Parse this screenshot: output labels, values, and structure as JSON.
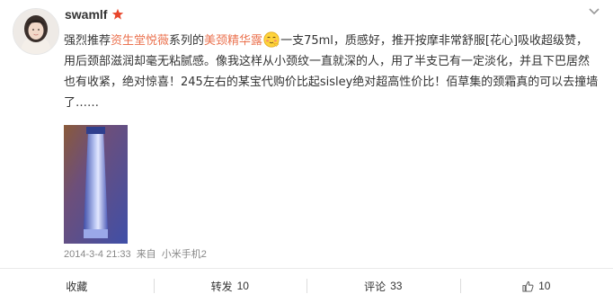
{
  "user": {
    "name": "swamlf",
    "vip_icon": "star-icon",
    "avatar_icon": "avatar-photo"
  },
  "post": {
    "text": [
      {
        "t": "强烈推荐",
        "hl": false
      },
      {
        "t": "资生堂悦薇",
        "hl": true
      },
      {
        "t": "系列的",
        "hl": false
      },
      {
        "t": "美颈精华露",
        "hl": true
      },
      {
        "emoji": "shy-smile-emoji"
      },
      {
        "t": "一支75ml，质感好，推开按摩非常舒服[花心]吸收超级赞，用后颈部滋润却毫无粘腻感。像我这样从小颈纹一直就深的人，用了半支已有一定淡化，并且下巴居然也有收紧，绝对惊喜！245左右的某宝代购价比起sisley绝对超高性价比！佰草集的颈霜真的可以去撞墙了……",
        "hl": false
      }
    ],
    "image": "neck-cream-tube-photo"
  },
  "meta": {
    "time": "2014-3-4 21:33",
    "from": "来自",
    "device": "小米手机2"
  },
  "actions": {
    "favorite": "收藏",
    "repost_label": "转发",
    "repost_count": "10",
    "comment_label": "评论",
    "comment_count": "33",
    "like_count": "10",
    "like_icon": "thumbs-up-icon"
  },
  "colors": {
    "highlight": "#eb7350",
    "vip": "#e8462c",
    "meta": "#888888"
  }
}
